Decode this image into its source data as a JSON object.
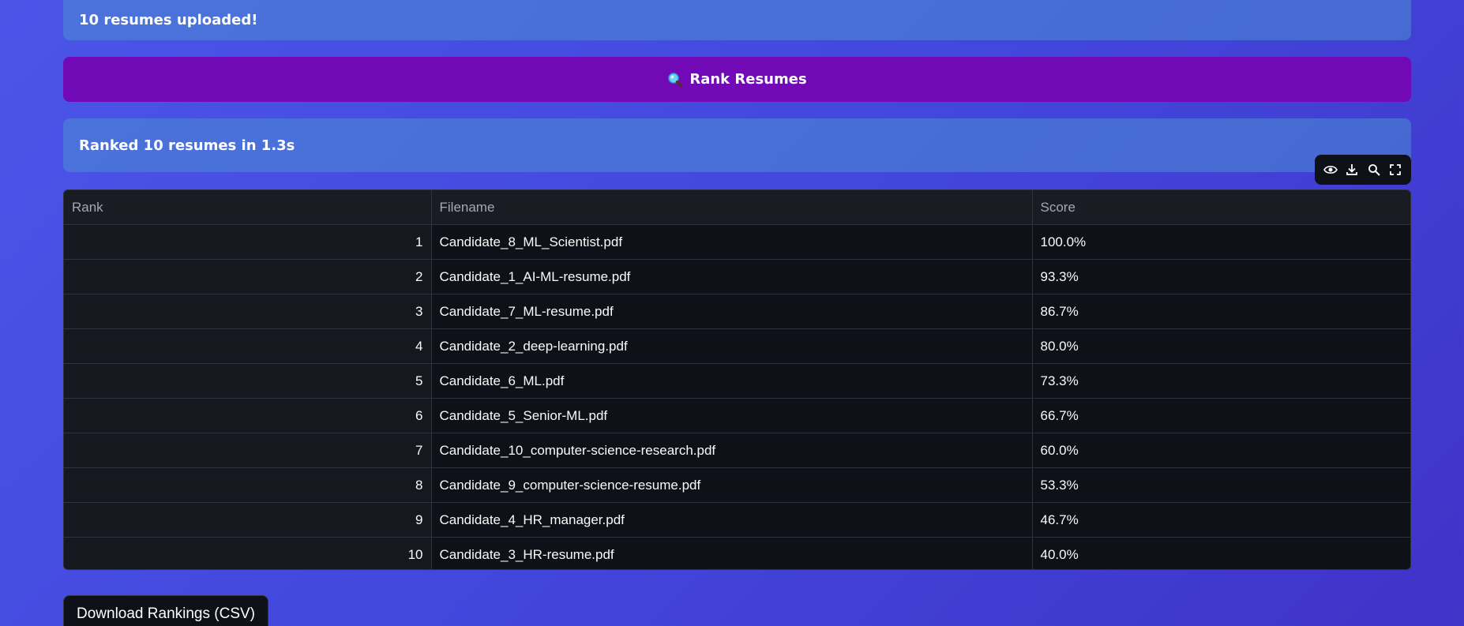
{
  "upload_alert": "10 resumes uploaded!",
  "rank_button": {
    "label": "Rank Resumes",
    "icon": "magnifier-icon"
  },
  "result_alert": "Ranked 10 resumes in 1.3s",
  "toolbar": {
    "icons": [
      "eye-icon",
      "download-icon",
      "search-icon",
      "fullscreen-icon"
    ]
  },
  "table": {
    "columns": [
      "Rank",
      "Filename",
      "Score"
    ],
    "rows": [
      {
        "rank": "1",
        "filename": "Candidate_8_ML_Scientist.pdf",
        "score": "100.0%"
      },
      {
        "rank": "2",
        "filename": "Candidate_1_AI-ML-resume.pdf",
        "score": "93.3%"
      },
      {
        "rank": "3",
        "filename": "Candidate_7_ML-resume.pdf",
        "score": "86.7%"
      },
      {
        "rank": "4",
        "filename": "Candidate_2_deep-learning.pdf",
        "score": "80.0%"
      },
      {
        "rank": "5",
        "filename": "Candidate_6_ML.pdf",
        "score": "73.3%"
      },
      {
        "rank": "6",
        "filename": "Candidate_5_Senior-ML.pdf",
        "score": "66.7%"
      },
      {
        "rank": "7",
        "filename": "Candidate_10_computer-science-research.pdf",
        "score": "60.0%"
      },
      {
        "rank": "8",
        "filename": "Candidate_9_computer-science-resume.pdf",
        "score": "53.3%"
      },
      {
        "rank": "9",
        "filename": "Candidate_4_HR_manager.pdf",
        "score": "46.7%"
      },
      {
        "rank": "10",
        "filename": "Candidate_3_HR-resume.pdf",
        "score": "40.0%"
      }
    ]
  },
  "download_button": "Download Rankings (CSV)",
  "colors": {
    "accent": "#7209b7",
    "alert_bg": "#4d8cd2",
    "table_bg": "#0e1117"
  }
}
